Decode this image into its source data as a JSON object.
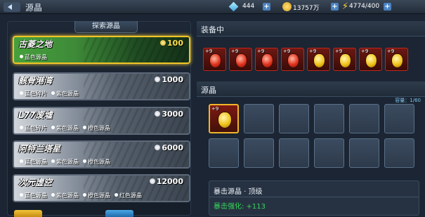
{
  "header": {
    "title": "源晶",
    "gems": "444",
    "gold": "13757万",
    "energy": "4774/400"
  },
  "explore": {
    "title": "探索源晶",
    "areas": [
      {
        "name": "古菱之地",
        "cost": "100",
        "selected": true,
        "tags": [
          "蓝色源晶"
        ]
      },
      {
        "name": "骸骨港湾",
        "cost": "1000",
        "selected": false,
        "tags": [
          "蓝色碎片",
          "紫色源晶"
        ]
      },
      {
        "name": "L77废墟",
        "cost": "3000",
        "selected": false,
        "tags": [
          "蓝色碎片",
          "紫色源晶",
          "橙色源晶"
        ]
      },
      {
        "name": "阿特兰塔星",
        "cost": "6000",
        "selected": false,
        "tags": [
          "蓝色源晶",
          "紫色源晶",
          "橙色源晶"
        ]
      },
      {
        "name": "次元虚空",
        "cost": "12000",
        "selected": false,
        "tags": [
          "蓝色源晶",
          "紫色源晶",
          "橙色源晶",
          "红色源晶"
        ]
      }
    ]
  },
  "equipped": {
    "title": "装备中",
    "slots": [
      {
        "level": "+9",
        "color": "red"
      },
      {
        "level": "+9",
        "color": "red"
      },
      {
        "level": "+9",
        "color": "red"
      },
      {
        "level": "+9",
        "color": "red"
      },
      {
        "level": "+9",
        "color": "gold"
      },
      {
        "level": "+9",
        "color": "gold"
      },
      {
        "level": "+9",
        "color": "gold"
      },
      {
        "level": "+9",
        "color": "gold"
      }
    ]
  },
  "inventory": {
    "title": "源晶",
    "capacity": "容量：1/60",
    "first_item_level": "+9",
    "selected_item": {
      "name": "暴击源晶 · 顶级",
      "stat": "暴击强化: +113"
    }
  }
}
